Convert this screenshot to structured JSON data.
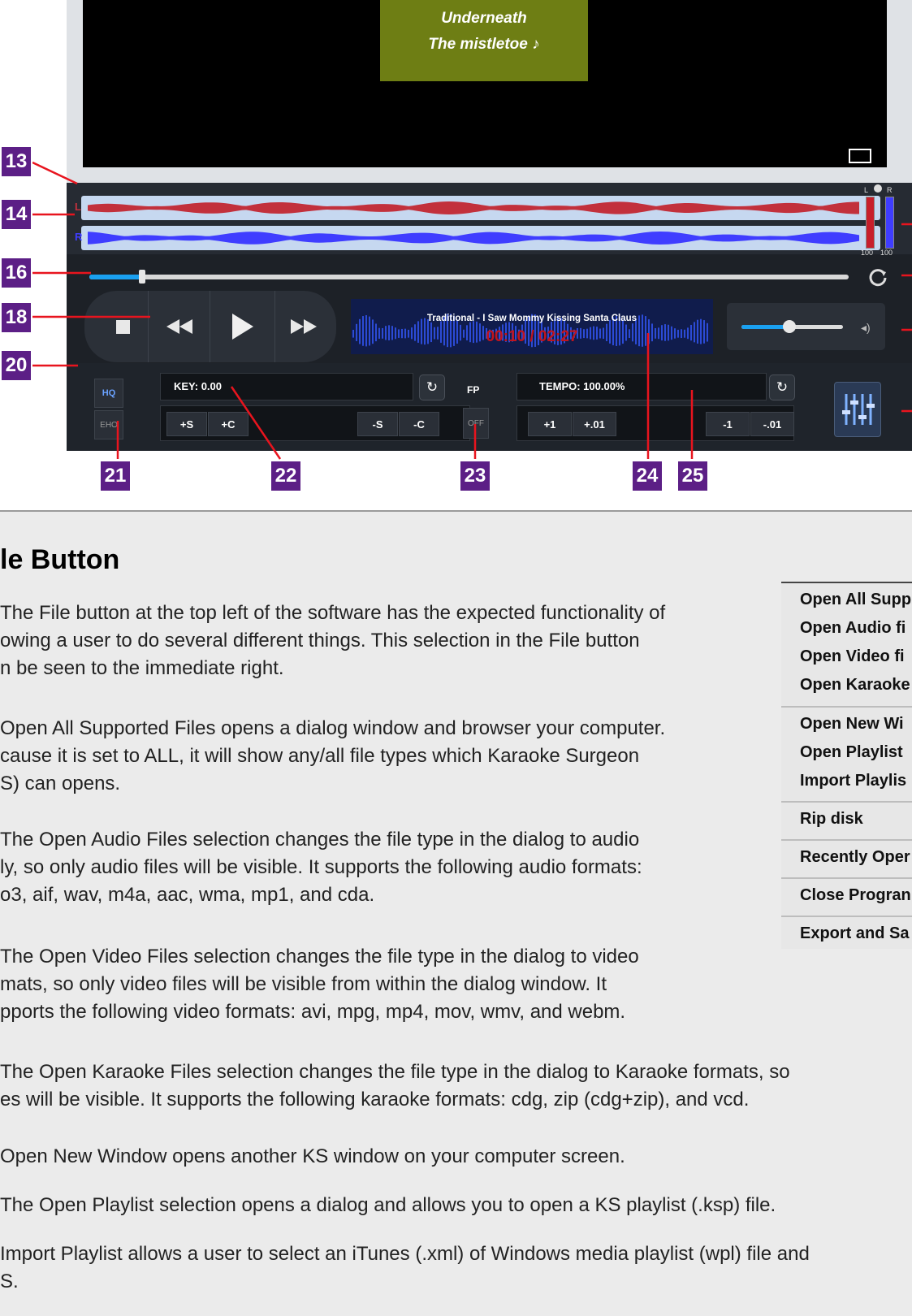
{
  "lyrics": {
    "line1": "Underneath",
    "line2": "The mistletoe ♪"
  },
  "waveform": {
    "left_tag": "L",
    "right_tag": "R"
  },
  "meters": {
    "left_label": "L",
    "right_label": "R",
    "left_value": "100",
    "right_value": "100"
  },
  "playback": {
    "track_title": "Traditional - I Saw Mommy Kissing Santa Claus",
    "time": "00:10 / 02:27",
    "progress_fraction": 0.07,
    "volume_fraction": 0.47
  },
  "controls": {
    "hq_label": "HQ",
    "eho_label": "EHO",
    "key_display": "KEY: 0.00",
    "key_plus_s": "+S",
    "key_plus_c": "+C",
    "key_minus_s": "-S",
    "key_minus_c": "-C",
    "fp_label": "FP",
    "fp_state": "OFF",
    "tempo_display": "TEMPO: 100.00%",
    "tempo_plus_1": "+1",
    "tempo_plus_01": "+.01",
    "tempo_minus_1": "-1",
    "tempo_minus_01": "-.01"
  },
  "callouts": [
    "13",
    "14",
    "16",
    "18",
    "20",
    "21",
    "22",
    "23",
    "24",
    "25"
  ],
  "document": {
    "heading": "le Button",
    "paragraphs": [
      [
        "The File button at the top left of the software has the expected functionality of",
        "owing a user to do several different things.  This selection in the File button",
        "n be seen to the immediate right."
      ],
      [
        "Open All Supported Files opens a dialog window and browser your computer.",
        "cause it is set to ALL,  it will show any/all file types which Karaoke Surgeon",
        "S) can opens."
      ],
      [
        "The Open Audio Files selection changes the file type in the dialog to audio",
        "ly, so only audio files will be visible.  It supports the following audio formats:",
        "o3, aif, wav, m4a, aac, wma, mp1, and cda."
      ],
      [
        "The Open Video Files selection changes the file type in the dialog to video",
        "mats, so only video files will be visible from within the dialog window. It",
        "pports the following video formats: avi, mpg, mp4, mov, wmv, and webm."
      ],
      [
        "The Open Karaoke Files selection changes the file type in the dialog to Karaoke formats, so",
        "es will be visible. It supports the following karaoke formats:  cdg, zip (cdg+zip), and vcd."
      ],
      [
        "Open New Window opens another KS window on your computer screen."
      ],
      [
        "The Open Playlist selection opens a dialog and allows you to open a KS playlist (.ksp) file."
      ],
      [
        "Import Playlist allows a user to select an iTunes (.xml) of Windows media playlist (wpl) file and",
        "S."
      ]
    ]
  },
  "file_menu": {
    "items": [
      "Open All Supp",
      "Open Audio fi",
      "Open Video fi",
      "Open Karaoke",
      "Open New Wi",
      "Open Playlist",
      "Import Playlis",
      "Rip disk",
      "Recently Oper",
      "Close Progran",
      "Export and Sa"
    ]
  },
  "colors": {
    "callout": "#5c1f86",
    "leader": "#e8141e",
    "time_red": "#c0141e",
    "left_wave": "#c2303c",
    "right_wave": "#3f3dff"
  }
}
